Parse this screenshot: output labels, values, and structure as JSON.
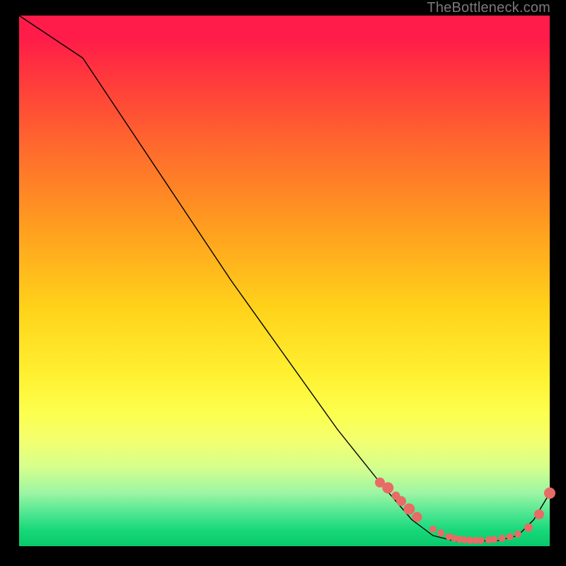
{
  "watermark": "TheBottleneck.com",
  "chart_data": {
    "type": "line",
    "title": "",
    "xlabel": "",
    "ylabel": "",
    "xlim": [
      0,
      100
    ],
    "ylim": [
      0,
      100
    ],
    "grid": false,
    "background": "red-yellow-green vertical gradient",
    "series": [
      {
        "name": "curve",
        "kind": "line",
        "x": [
          0,
          3,
          12,
          20,
          30,
          40,
          50,
          60,
          68,
          74,
          78,
          82,
          86,
          90,
          94,
          97,
          100
        ],
        "y": [
          100,
          98,
          92,
          80,
          65,
          50,
          36,
          22,
          12,
          5,
          2,
          1,
          1,
          1,
          2,
          5,
          10
        ]
      },
      {
        "name": "points",
        "kind": "scatter",
        "x": [
          68,
          69.5,
          71,
          72,
          73.5,
          75,
          78,
          79.5,
          81,
          82,
          83,
          84,
          85,
          86,
          87,
          88.5,
          89.5,
          91,
          92.5,
          94,
          96,
          98,
          100
        ],
        "y": [
          12,
          11,
          9.5,
          8.5,
          7,
          5.5,
          3.2,
          2.5,
          1.8,
          1.5,
          1.3,
          1.2,
          1.1,
          1.1,
          1.1,
          1.2,
          1.3,
          1.5,
          1.8,
          2.3,
          3.5,
          6,
          10
        ],
        "r": [
          7,
          8,
          6,
          7,
          8,
          7,
          5,
          5,
          5,
          5,
          5,
          5,
          5,
          5,
          5,
          5,
          5,
          5,
          5,
          5,
          6,
          7,
          8
        ]
      }
    ]
  }
}
